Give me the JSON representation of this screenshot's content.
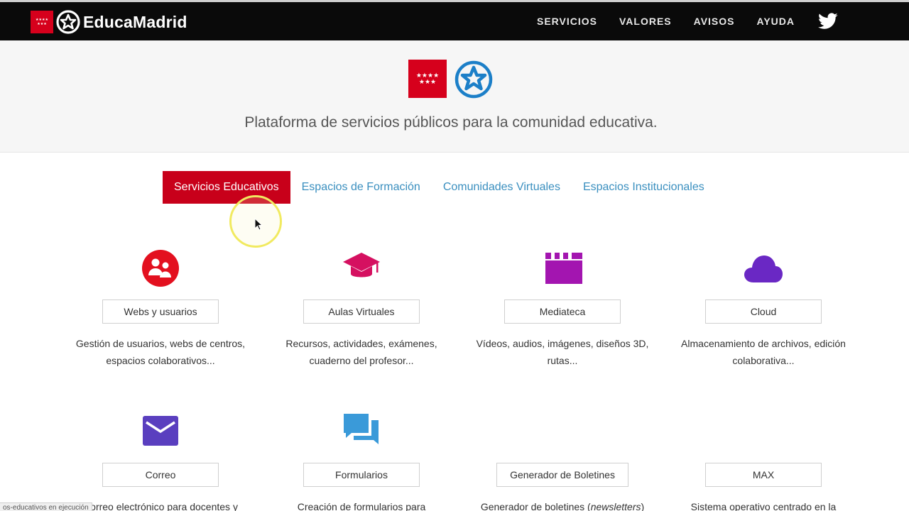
{
  "header": {
    "brand_name": "EducaMadrid",
    "nav": [
      "SERVICIOS",
      "VALORES",
      "AVISOS",
      "AYUDA"
    ]
  },
  "hero": {
    "tagline": "Plataforma de servicios públicos para la comunidad educativa."
  },
  "tabs": [
    {
      "label": "Servicios Educativos",
      "active": true
    },
    {
      "label": "Espacios de Formación",
      "active": false
    },
    {
      "label": "Comunidades Virtuales",
      "active": false
    },
    {
      "label": "Espacios Institucionales",
      "active": false
    }
  ],
  "services": [
    {
      "label": "Webs y usuarios",
      "icon": "users-circle-icon",
      "color": "#e3101f",
      "desc1": "Gestión de usuarios, webs de centros,",
      "desc2": "espacios colaborativos..."
    },
    {
      "label": "Aulas Virtuales",
      "icon": "graduation-cap-icon",
      "color": "#d51060",
      "desc1": "Recursos, actividades, exámenes,",
      "desc2": "cuaderno del profesor..."
    },
    {
      "label": "Mediateca",
      "icon": "clapperboard-icon",
      "color": "#a315b0",
      "desc1": "Vídeos, audios, imágenes, diseños 3D,",
      "desc2": "rutas..."
    },
    {
      "label": "Cloud",
      "icon": "cloud-icon",
      "color": "#6a28c4",
      "desc1": "Almacenamiento de archivos, edición",
      "desc2": "colaborativa..."
    },
    {
      "label": "Correo",
      "icon": "envelope-icon",
      "color": "#5a3fbf",
      "desc1": "Correo electrónico para docentes y"
    },
    {
      "label": "Formularios",
      "icon": "chat-bubbles-icon",
      "color": "#3a9ad9",
      "desc1": "Creación de formularios para"
    },
    {
      "label": "Generador de Boletines",
      "desc1_pre": "Generador de boletines (",
      "desc1_em": "newsletters",
      "desc1_post": ")"
    },
    {
      "label": "MAX",
      "desc1": "Sistema operativo centrado en la"
    }
  ],
  "statusbar": {
    "text": "os-educativos en ejecución"
  }
}
